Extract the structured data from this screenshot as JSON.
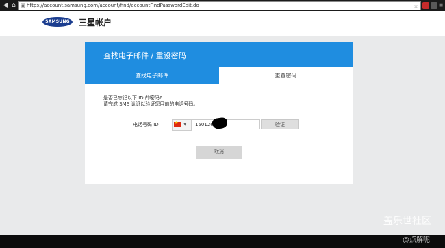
{
  "browser": {
    "url": "https://account.samsung.com/account/find/accountFindPasswordEdit.do"
  },
  "header": {
    "logo_text": "SAMSUNG",
    "title": "三星帐户"
  },
  "card": {
    "title": "查找电子邮件 / 重设密码",
    "tabs": [
      {
        "label": "查找电子邮件",
        "active": false
      },
      {
        "label": "重置密码",
        "active": true
      }
    ],
    "message_line1": "是否已忘记以下 ID 的密码?",
    "message_line2": "请完成 SMS 认证以验证您目前的电话号码。",
    "phone_label": "电话号码 ID",
    "phone_value": "150126",
    "verify_label": "验证",
    "cancel_label": "取消"
  },
  "watermark": {
    "line1": "盖乐世社区",
    "line2": "@点解呢"
  },
  "colors": {
    "accent": "#1f8de0",
    "header_bg": "#ffffff",
    "page_bg": "#e9eaeb"
  }
}
